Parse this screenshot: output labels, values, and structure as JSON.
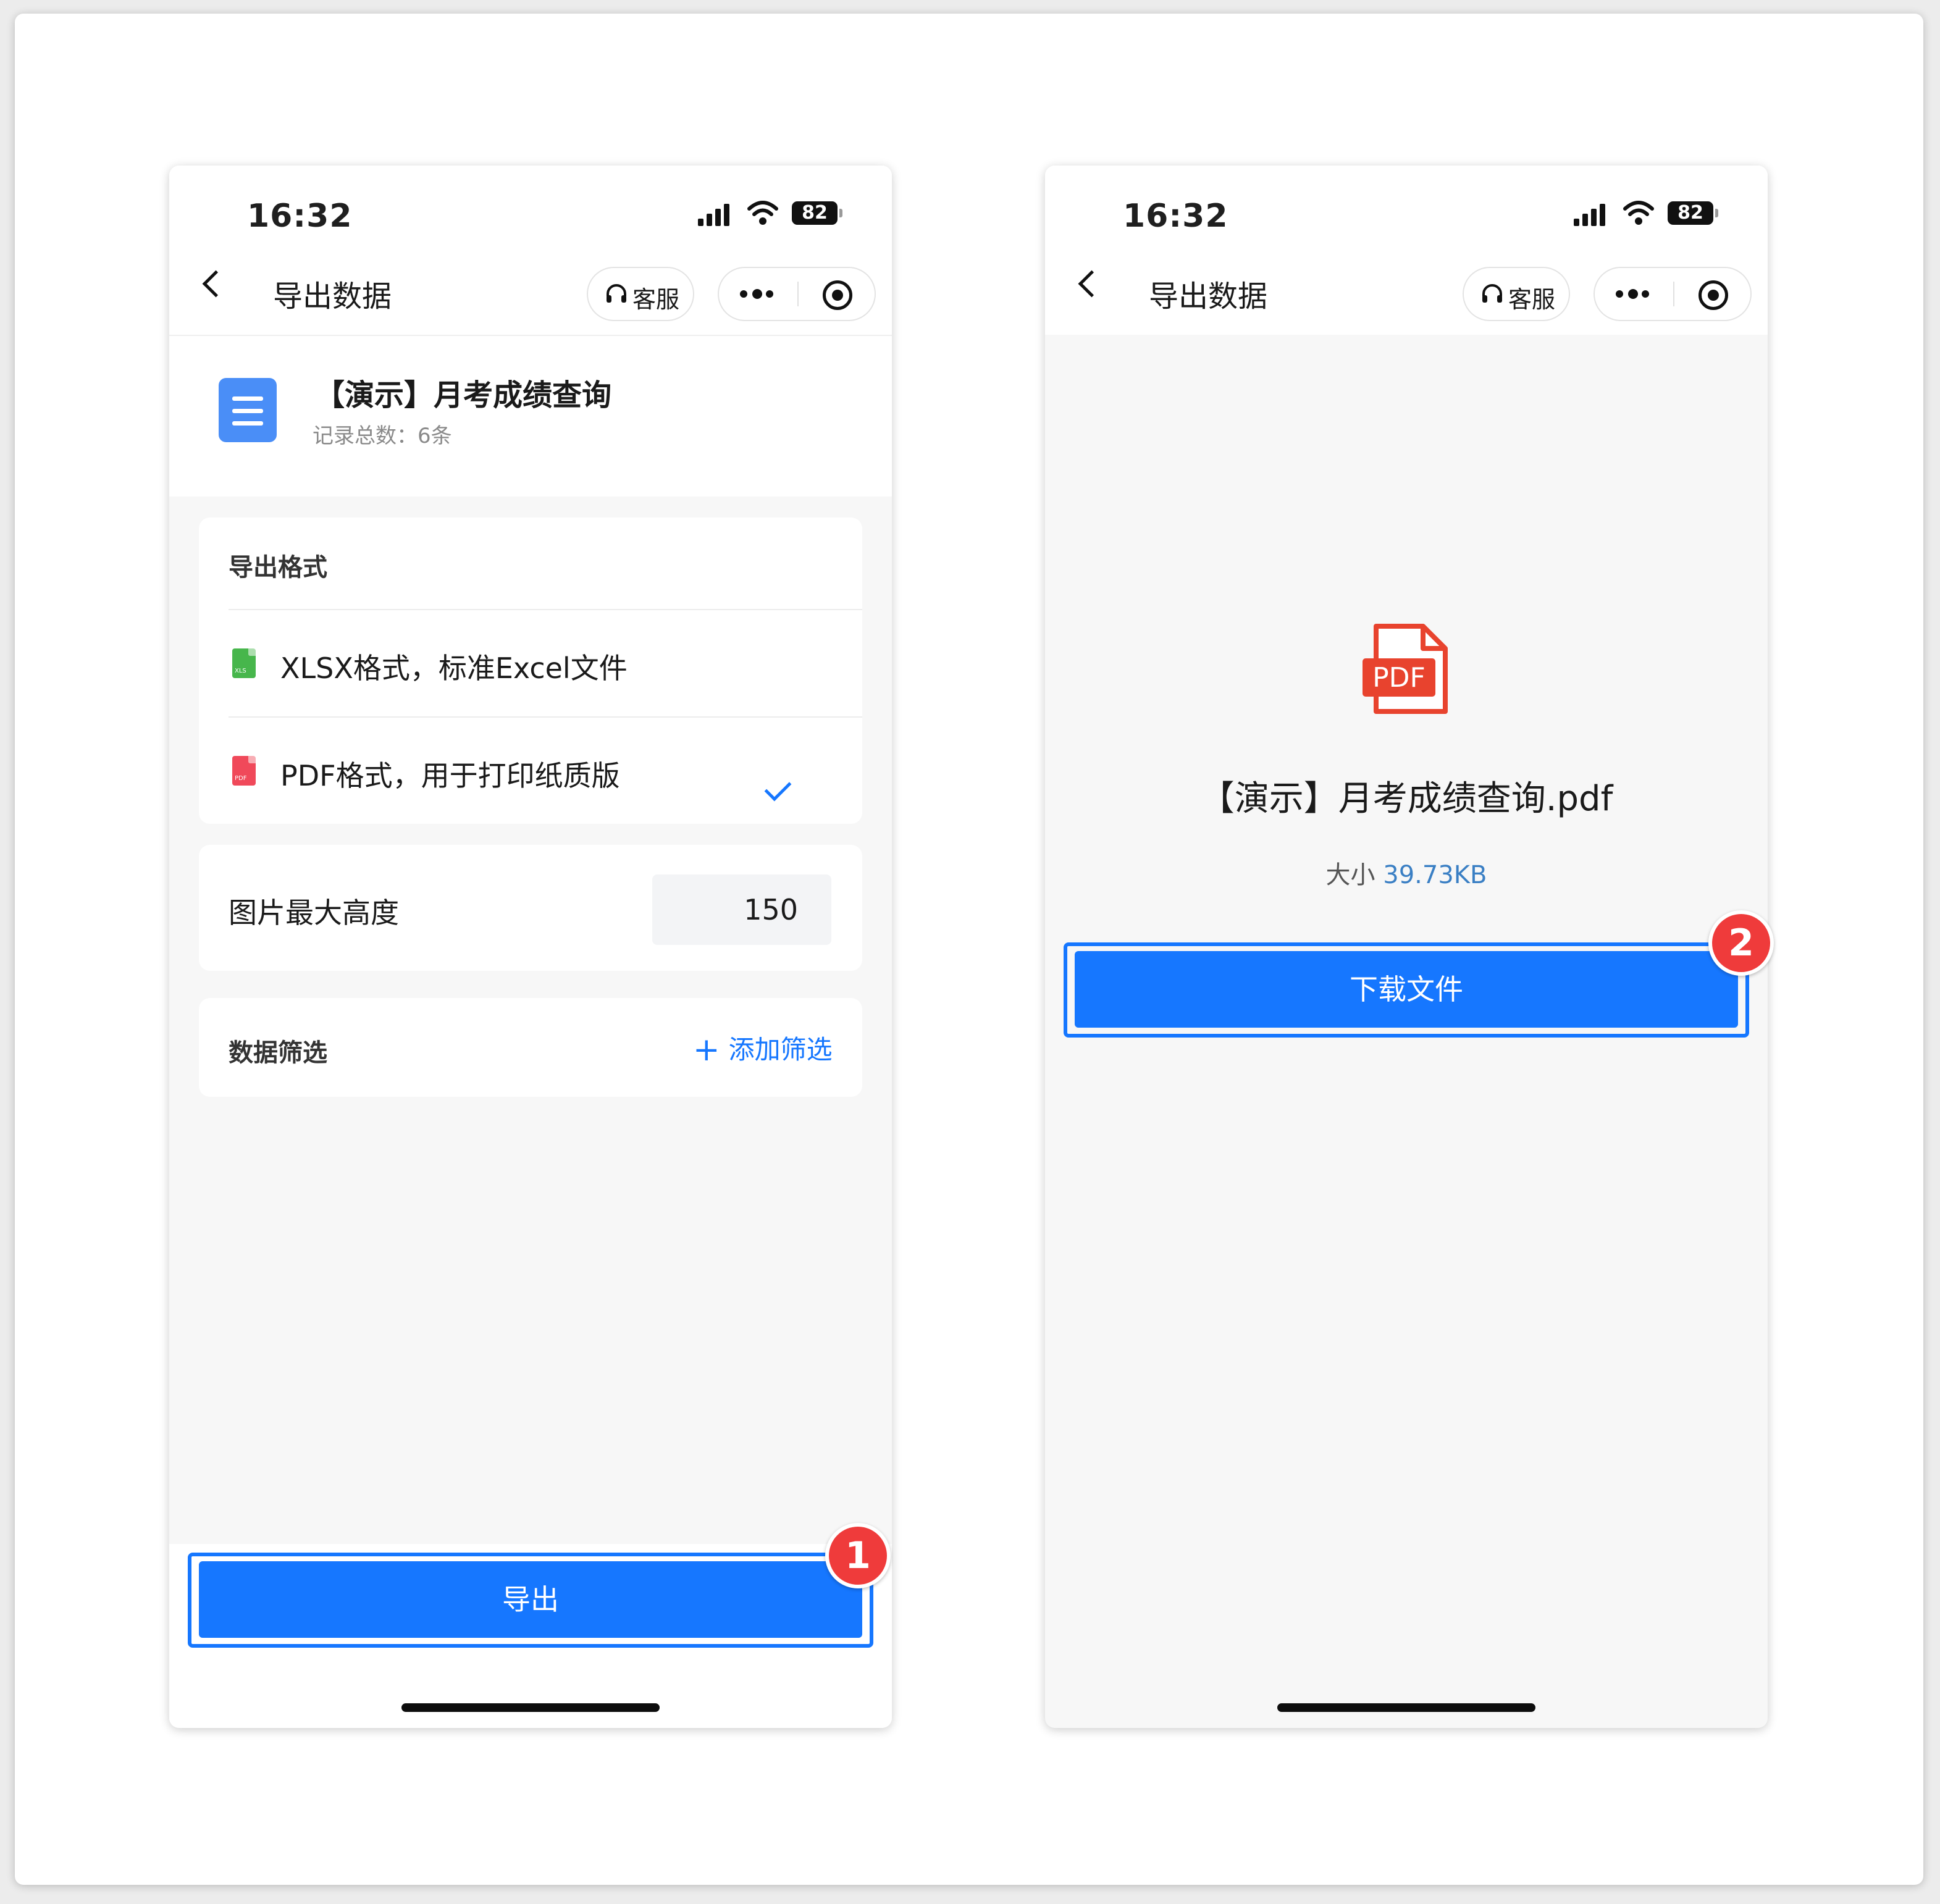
{
  "left_screen": {
    "status_bar": {
      "time": "16:32",
      "battery": "82"
    },
    "nav": {
      "title": "导出数据",
      "service_label": "客服"
    },
    "document": {
      "title": "【演示】月考成绩查询",
      "record_count": "记录总数：6条"
    },
    "export_format": {
      "label": "导出格式",
      "options": [
        {
          "label": "XLSX格式，标准Excel文件",
          "icon": "xls-file-icon",
          "selected": false
        },
        {
          "label": "PDF格式，用于打印纸质版",
          "icon": "pdf-file-icon",
          "selected": true
        }
      ]
    },
    "image_max_height": {
      "label": "图片最大高度",
      "value": "150"
    },
    "data_filter": {
      "label": "数据筛选",
      "add_label": "添加筛选"
    },
    "export_button": "导出",
    "step_badge": "1"
  },
  "right_screen": {
    "status_bar": {
      "time": "16:32",
      "battery": "82"
    },
    "nav": {
      "title": "导出数据",
      "service_label": "客服"
    },
    "file_name": "【演示】月考成绩查询.pdf",
    "size_label": "大小",
    "size_value": "39.73KB",
    "download_button": "下载文件",
    "step_badge": "2"
  },
  "colors": {
    "accent": "#1677ff",
    "badge": "#ef3b3b",
    "pdf_red": "#e8432e",
    "xls_green": "#47b64c"
  }
}
